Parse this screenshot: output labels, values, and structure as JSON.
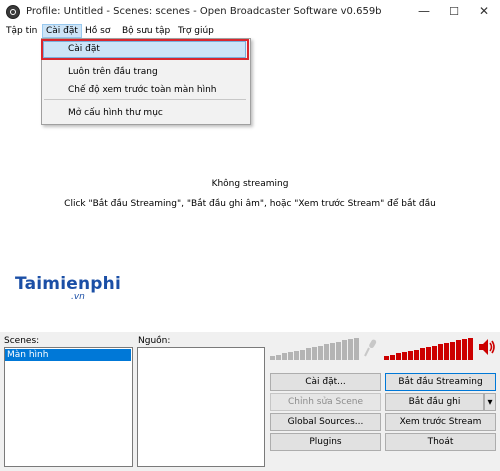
{
  "window": {
    "title": "Profile: Untitled - Scenes: scenes - Open Broadcaster Software v0.659b",
    "minimize": "—",
    "maximize": "☐",
    "close": "✕"
  },
  "menubar": {
    "items": [
      "Tập tin",
      "Cài đặt",
      "Hồ sơ",
      "Bộ sưu tập",
      "Trợ giúp"
    ]
  },
  "dropdown": {
    "items": [
      "Cài đặt",
      "Luôn trên đầu trang",
      "Chế độ xem trước toàn màn hình",
      "Mở  cấu hình thư mục"
    ]
  },
  "preview": {
    "status": "Không streaming",
    "hint": "Click \"Bắt đầu Streaming\", \"Bắt đầu ghi âm\", hoặc \"Xem trước Stream\" để bắt đầu"
  },
  "watermark": {
    "brand": "Taimienphi",
    "suffix": ".vn"
  },
  "scenes": {
    "label": "Scenes:",
    "items": [
      "Màn hình"
    ]
  },
  "sources": {
    "label": "Nguồn:"
  },
  "buttons": {
    "settings": "Cài đặt...",
    "start_streaming": "Bắt đầu Streaming",
    "edit_scene": "Chỉnh sửa Scene",
    "start_recording": "Bắt đầu ghi",
    "record_arrow": "▾",
    "global_sources": "Global Sources...",
    "preview_stream": "Xem trước Stream",
    "plugins": "Plugins",
    "exit": "Thoát"
  },
  "audio": {
    "mic_level": 0.0,
    "desktop_level": 1.0,
    "muted_color": "#b4b4b4",
    "active_color": "#cc0000"
  },
  "colors": {
    "selection": "#0078d7",
    "highlight_box": "#d9272e",
    "menu_hover": "#cce4f7",
    "logo": "#1b4fa6"
  }
}
